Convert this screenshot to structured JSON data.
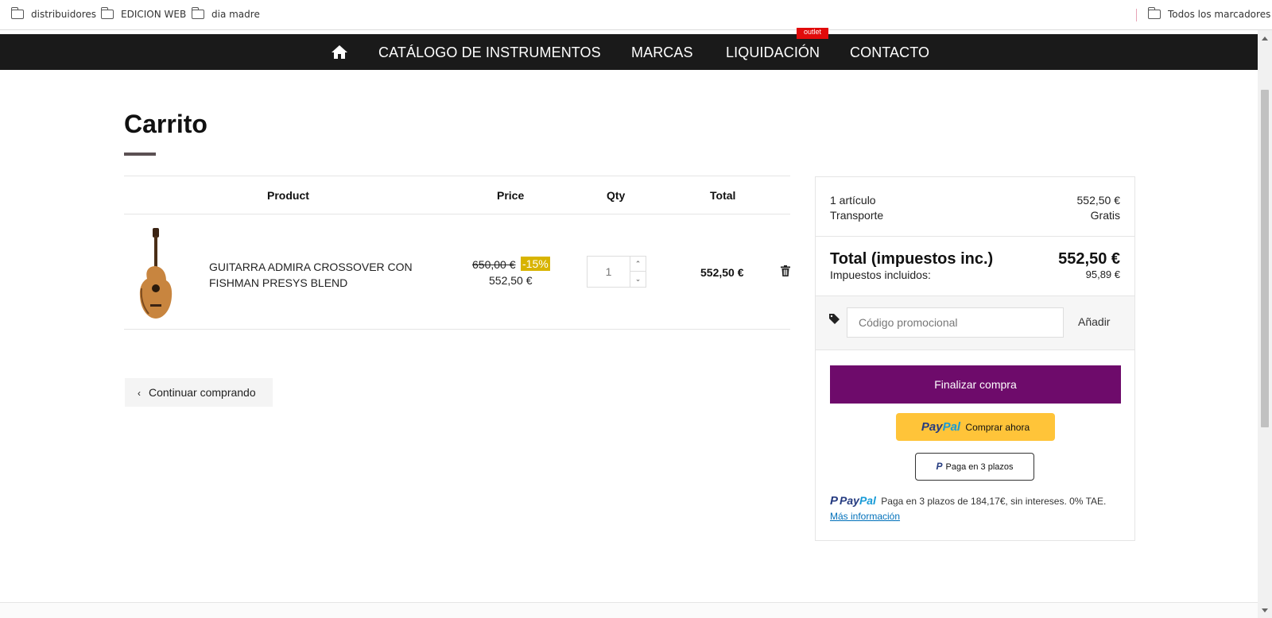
{
  "bookmarks": {
    "items": [
      {
        "label": "distribuidores",
        "icon": "folder-icon"
      },
      {
        "label": "EDICION WEB",
        "icon": "folder-icon"
      },
      {
        "label": "dia madre",
        "icon": "folder-icon"
      }
    ],
    "all_bookmarks": "Todos los marcadores"
  },
  "nav": {
    "home_icon": "home-icon",
    "items": [
      "CATÁLOGO DE INSTRUMENTOS",
      "MARCAS",
      "LIQUIDACIÓN",
      "CONTACTO"
    ],
    "badge": "outlet",
    "badge_color": "#e10b0b",
    "background": "#1a1a1a"
  },
  "page": {
    "title": "Carrito"
  },
  "cart": {
    "headers": {
      "product": "Product",
      "price": "Price",
      "qty": "Qty",
      "total": "Total"
    },
    "items": [
      {
        "name": "GUITARRA ADMIRA CROSSOVER CON FISHMAN PRESYS BLEND",
        "old_price": "650,00 €",
        "discount": "-15%",
        "price": "552,50 €",
        "qty": "1",
        "total": "552,50 €",
        "remove_icon": "trash-icon"
      }
    ],
    "continue_label": "Continuar comprando"
  },
  "summary": {
    "items_label": "1 artículo",
    "items_value": "552,50 €",
    "shipping_label": "Transporte",
    "shipping_value": "Gratis",
    "total_label": "Total (impuestos inc.)",
    "total_value": "552,50 €",
    "tax_label": "Impuestos incluidos:",
    "tax_value": "95,89 €",
    "promo_placeholder": "Código promocional",
    "promo_add": "Añadir",
    "checkout_label": "Finalizar compra",
    "checkout_color": "#6e0b6b",
    "paypal_pay": "Pay",
    "paypal_pal": "Pal",
    "paypal_buy": "Comprar ahora",
    "plazos_label": "Paga en 3 plazos",
    "pp_message": "Paga en 3 plazos de 184,17€, sin intereses. 0% TAE.",
    "pp_more": "Más información"
  }
}
